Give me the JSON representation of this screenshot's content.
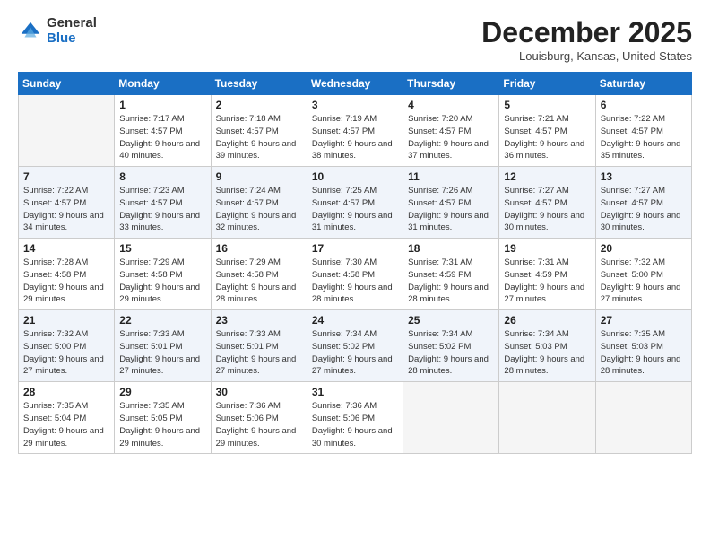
{
  "logo": {
    "general": "General",
    "blue": "Blue"
  },
  "title": "December 2025",
  "location": "Louisburg, Kansas, United States",
  "days_of_week": [
    "Sunday",
    "Monday",
    "Tuesday",
    "Wednesday",
    "Thursday",
    "Friday",
    "Saturday"
  ],
  "weeks": [
    [
      {
        "day": "",
        "empty": true
      },
      {
        "day": "1",
        "sunrise": "7:17 AM",
        "sunset": "4:57 PM",
        "daylight": "9 hours and 40 minutes."
      },
      {
        "day": "2",
        "sunrise": "7:18 AM",
        "sunset": "4:57 PM",
        "daylight": "9 hours and 39 minutes."
      },
      {
        "day": "3",
        "sunrise": "7:19 AM",
        "sunset": "4:57 PM",
        "daylight": "9 hours and 38 minutes."
      },
      {
        "day": "4",
        "sunrise": "7:20 AM",
        "sunset": "4:57 PM",
        "daylight": "9 hours and 37 minutes."
      },
      {
        "day": "5",
        "sunrise": "7:21 AM",
        "sunset": "4:57 PM",
        "daylight": "9 hours and 36 minutes."
      },
      {
        "day": "6",
        "sunrise": "7:22 AM",
        "sunset": "4:57 PM",
        "daylight": "9 hours and 35 minutes."
      }
    ],
    [
      {
        "day": "7",
        "sunrise": "7:22 AM",
        "sunset": "4:57 PM",
        "daylight": "9 hours and 34 minutes."
      },
      {
        "day": "8",
        "sunrise": "7:23 AM",
        "sunset": "4:57 PM",
        "daylight": "9 hours and 33 minutes."
      },
      {
        "day": "9",
        "sunrise": "7:24 AM",
        "sunset": "4:57 PM",
        "daylight": "9 hours and 32 minutes."
      },
      {
        "day": "10",
        "sunrise": "7:25 AM",
        "sunset": "4:57 PM",
        "daylight": "9 hours and 31 minutes."
      },
      {
        "day": "11",
        "sunrise": "7:26 AM",
        "sunset": "4:57 PM",
        "daylight": "9 hours and 31 minutes."
      },
      {
        "day": "12",
        "sunrise": "7:27 AM",
        "sunset": "4:57 PM",
        "daylight": "9 hours and 30 minutes."
      },
      {
        "day": "13",
        "sunrise": "7:27 AM",
        "sunset": "4:57 PM",
        "daylight": "9 hours and 30 minutes."
      }
    ],
    [
      {
        "day": "14",
        "sunrise": "7:28 AM",
        "sunset": "4:58 PM",
        "daylight": "9 hours and 29 minutes."
      },
      {
        "day": "15",
        "sunrise": "7:29 AM",
        "sunset": "4:58 PM",
        "daylight": "9 hours and 29 minutes."
      },
      {
        "day": "16",
        "sunrise": "7:29 AM",
        "sunset": "4:58 PM",
        "daylight": "9 hours and 28 minutes."
      },
      {
        "day": "17",
        "sunrise": "7:30 AM",
        "sunset": "4:58 PM",
        "daylight": "9 hours and 28 minutes."
      },
      {
        "day": "18",
        "sunrise": "7:31 AM",
        "sunset": "4:59 PM",
        "daylight": "9 hours and 28 minutes."
      },
      {
        "day": "19",
        "sunrise": "7:31 AM",
        "sunset": "4:59 PM",
        "daylight": "9 hours and 27 minutes."
      },
      {
        "day": "20",
        "sunrise": "7:32 AM",
        "sunset": "5:00 PM",
        "daylight": "9 hours and 27 minutes."
      }
    ],
    [
      {
        "day": "21",
        "sunrise": "7:32 AM",
        "sunset": "5:00 PM",
        "daylight": "9 hours and 27 minutes."
      },
      {
        "day": "22",
        "sunrise": "7:33 AM",
        "sunset": "5:01 PM",
        "daylight": "9 hours and 27 minutes."
      },
      {
        "day": "23",
        "sunrise": "7:33 AM",
        "sunset": "5:01 PM",
        "daylight": "9 hours and 27 minutes."
      },
      {
        "day": "24",
        "sunrise": "7:34 AM",
        "sunset": "5:02 PM",
        "daylight": "9 hours and 27 minutes."
      },
      {
        "day": "25",
        "sunrise": "7:34 AM",
        "sunset": "5:02 PM",
        "daylight": "9 hours and 28 minutes."
      },
      {
        "day": "26",
        "sunrise": "7:34 AM",
        "sunset": "5:03 PM",
        "daylight": "9 hours and 28 minutes."
      },
      {
        "day": "27",
        "sunrise": "7:35 AM",
        "sunset": "5:03 PM",
        "daylight": "9 hours and 28 minutes."
      }
    ],
    [
      {
        "day": "28",
        "sunrise": "7:35 AM",
        "sunset": "5:04 PM",
        "daylight": "9 hours and 29 minutes."
      },
      {
        "day": "29",
        "sunrise": "7:35 AM",
        "sunset": "5:05 PM",
        "daylight": "9 hours and 29 minutes."
      },
      {
        "day": "30",
        "sunrise": "7:36 AM",
        "sunset": "5:06 PM",
        "daylight": "9 hours and 29 minutes."
      },
      {
        "day": "31",
        "sunrise": "7:36 AM",
        "sunset": "5:06 PM",
        "daylight": "9 hours and 30 minutes."
      },
      {
        "day": "",
        "empty": true
      },
      {
        "day": "",
        "empty": true
      },
      {
        "day": "",
        "empty": true
      }
    ]
  ]
}
